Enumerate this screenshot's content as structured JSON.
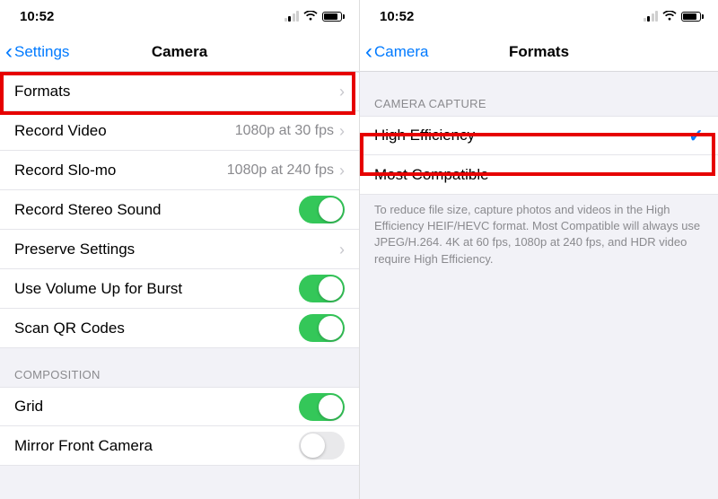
{
  "status": {
    "time": "10:52"
  },
  "left": {
    "back_label": "Settings",
    "title": "Camera",
    "rows": {
      "formats": "Formats",
      "record_video": {
        "label": "Record Video",
        "value": "1080p at 30 fps"
      },
      "record_slomo": {
        "label": "Record Slo-mo",
        "value": "1080p at 240 fps"
      },
      "stereo": "Record Stereo Sound",
      "preserve": "Preserve Settings",
      "volume_burst": "Use Volume Up for Burst",
      "scan_qr": "Scan QR Codes"
    },
    "composition_header": "Composition",
    "grid": "Grid",
    "mirror": "Mirror Front Camera"
  },
  "right": {
    "back_label": "Camera",
    "title": "Formats",
    "capture_header": "Camera Capture",
    "high_eff": "High Efficiency",
    "most_compat": "Most Compatible",
    "footer": "To reduce file size, capture photos and videos in the High Efficiency HEIF/HEVC format. Most Compatible will always use JPEG/H.264. 4K at 60 fps, 1080p at 240 fps, and HDR video require High Efficiency."
  }
}
